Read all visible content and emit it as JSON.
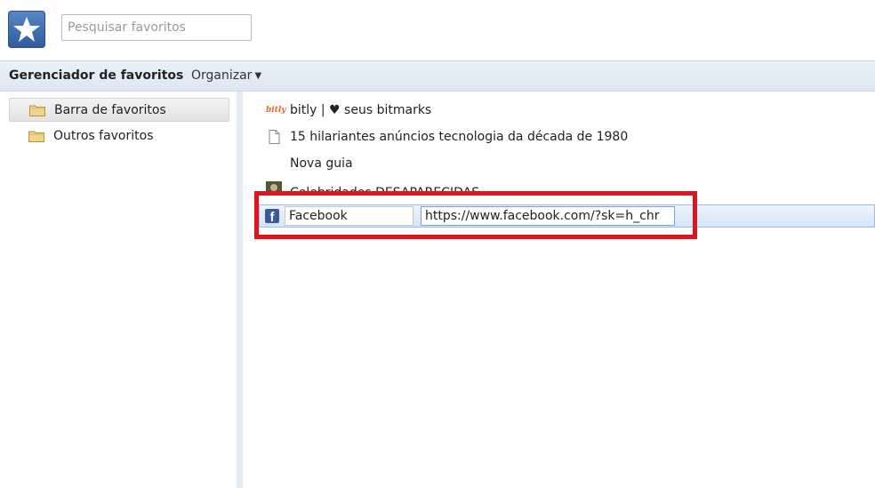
{
  "header": {
    "logo_icon": "star-icon",
    "search_placeholder": "Pesquisar favoritos"
  },
  "toolbar": {
    "title": "Gerenciador de favoritos",
    "organize_label": "Organizar",
    "organize_caret": "▼"
  },
  "sidebar": {
    "items": [
      {
        "label": "Barra de favoritos",
        "icon": "folder-icon",
        "selected": true
      },
      {
        "label": "Outros favoritos",
        "icon": "folder-icon",
        "selected": false
      }
    ]
  },
  "bookmarks": [
    {
      "title": "bitly | ♥ seus bitmarks",
      "icon": "bitly-icon",
      "icon_text": "bitly"
    },
    {
      "title": "15 hilariantes anúncios tecnologia da década de 1980",
      "icon": "page-icon"
    },
    {
      "title": "Nova guia",
      "icon": "none"
    },
    {
      "title": "Celebridades DESAPARECIDAS",
      "icon": "thumbnail-icon"
    }
  ],
  "editing": {
    "icon": "facebook-icon",
    "icon_text": "f",
    "name_value": "Facebook",
    "url_value": "https://www.facebook.com/?sk=h_chr"
  },
  "colors": {
    "accent": "#3b5998",
    "highlight": "#e0141e",
    "toolbar_bg": "#e4ecf5"
  }
}
